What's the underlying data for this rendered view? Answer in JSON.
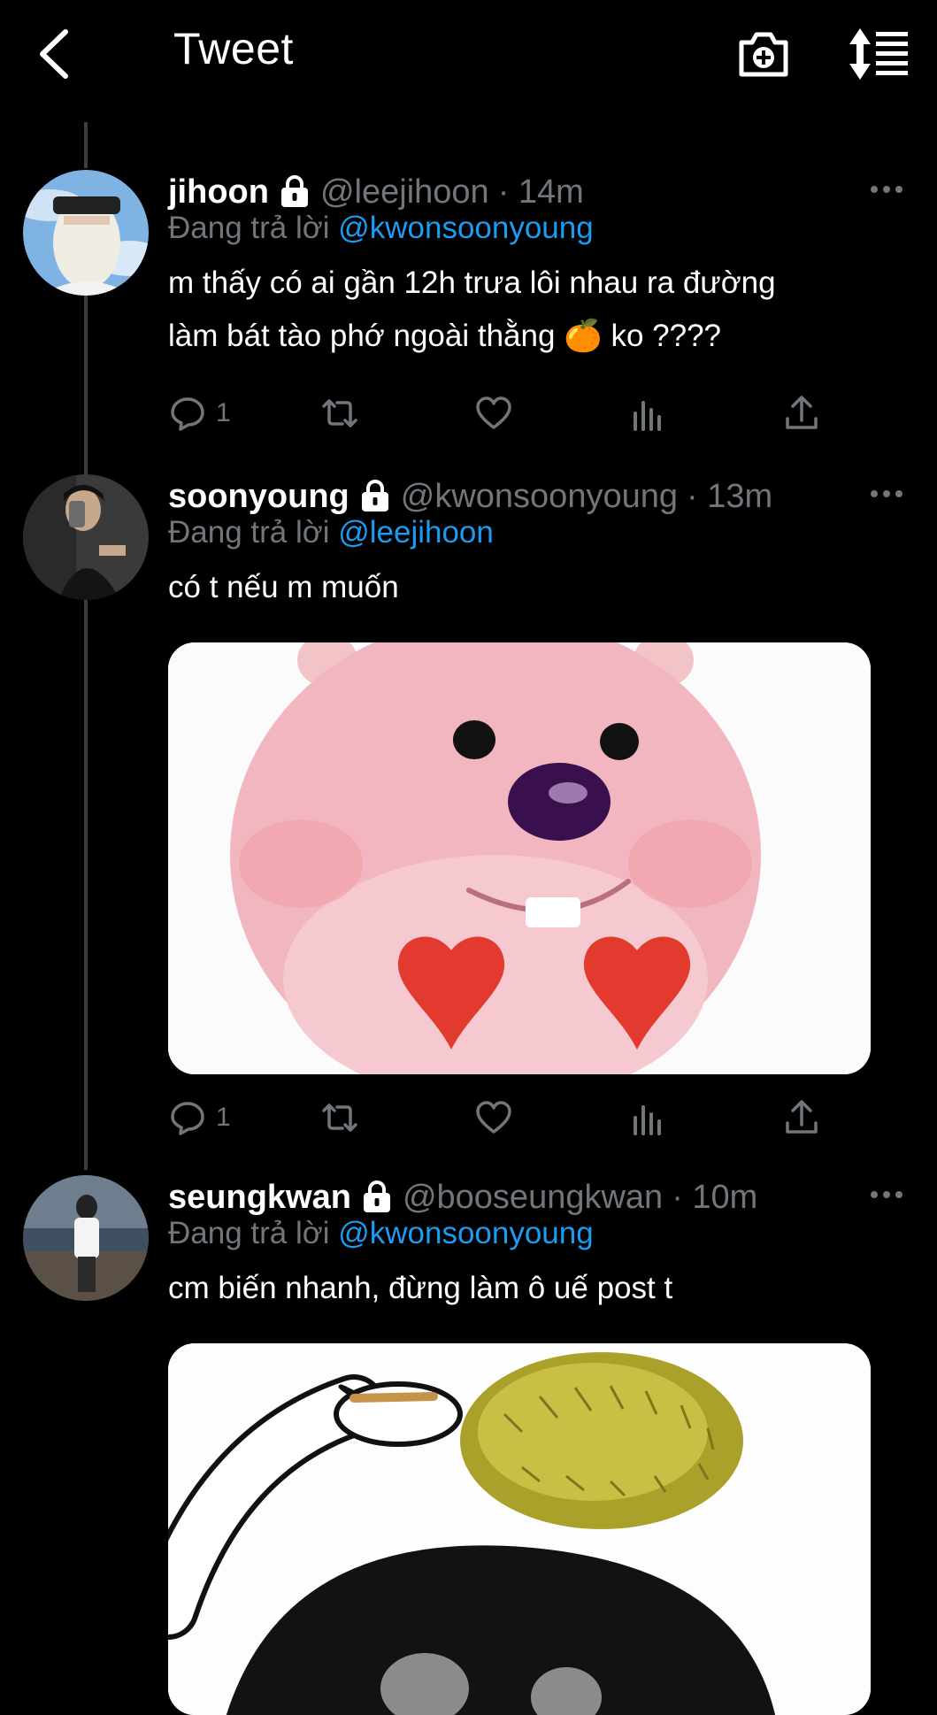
{
  "header": {
    "title": "Tweet",
    "back_icon": "chevron-left-icon",
    "camera_icon": "camera-plus-icon",
    "sort_icon": "sort-icon"
  },
  "colors": {
    "background": "#000000",
    "text": "#e7e9ea",
    "secondary": "#71767b",
    "accent": "#1d9bf0"
  },
  "tweets": [
    {
      "name": "jihoon",
      "handle": "@leejihoon",
      "time": "· 14m",
      "reply_prefix": "Đang trả lời ",
      "reply_mention": "@kwonsoonyoung",
      "lines": [
        "m thấy có ai gần 12h trưa lôi nhau ra đường",
        "làm bát tào phớ ngoài thằng 🍊 ko ????"
      ],
      "reply_count": "1"
    },
    {
      "name": "soonyoung",
      "handle": "@kwonsoonyoung",
      "time": "· 13m",
      "reply_prefix": "Đang trả lời ",
      "reply_mention": "@leejihoon",
      "lines": [
        "có t nếu m muốn"
      ],
      "reply_count": "1"
    },
    {
      "name": "seungkwan",
      "handle": "@booseungkwan",
      "time": "· 10m",
      "reply_prefix": "Đang trả lời ",
      "reply_mention": "@kwonsoonyoung",
      "lines": [
        "cm biến nhanh, đừng làm ô uế post t"
      ]
    }
  ]
}
